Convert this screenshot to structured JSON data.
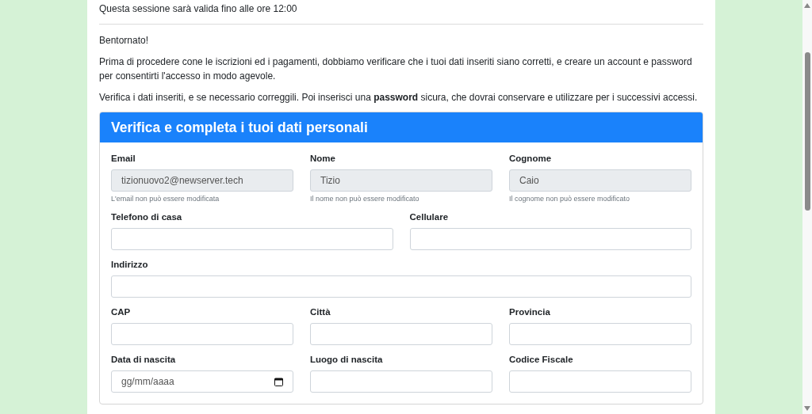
{
  "session_notice": "Questa sessione sarà valida fino alle ore 12:00",
  "greeting": "Bentornato!",
  "paragraphs": [
    "Prima di procedere cone le iscrizioni ed i pagamenti, dobbiamo verificare che i tuoi dati inseriti siano corretti, e creare un account e password per consentirti l'accesso in modo agevole.",
    "Verifica i dati inseriti, e se necessario correggili. Poi inserisci una **password** sicura, che dovrai conservare e utilizzare per i successivi accessi."
  ],
  "card": {
    "title": "Verifica e completa i tuoi dati personali",
    "rows": [
      [
        {
          "label": "Email",
          "kind": "text",
          "value": "tizionuovo2@newserver.tech",
          "disabled": true,
          "help": "L'email non può essere modificata"
        },
        {
          "label": "Nome",
          "kind": "text",
          "value": "Tizio",
          "disabled": true,
          "help": "Il nome non può essere modificato"
        },
        {
          "label": "Cognome",
          "kind": "text",
          "value": "Caio",
          "disabled": true,
          "help": "Il cognome non può essere modificato"
        }
      ],
      [
        {
          "label": "Telefono di casa",
          "kind": "text",
          "disabled": false
        },
        {
          "label": "Cellulare",
          "kind": "text",
          "disabled": false
        }
      ],
      [
        {
          "label": "Indirizzo",
          "kind": "text",
          "disabled": false
        }
      ],
      [
        {
          "label": "CAP",
          "kind": "text",
          "disabled": false
        },
        {
          "label": "Città",
          "kind": "text",
          "disabled": false
        },
        {
          "label": "Provincia",
          "kind": "text",
          "disabled": false
        }
      ],
      [
        {
          "label": "Data di nascita",
          "kind": "date",
          "placeholder": "gg/mm/aaaa",
          "disabled": false
        },
        {
          "label": "Luogo di nascita",
          "kind": "text",
          "disabled": false
        },
        {
          "label": "Codice Fiscale",
          "kind": "text",
          "disabled": false
        }
      ]
    ]
  }
}
